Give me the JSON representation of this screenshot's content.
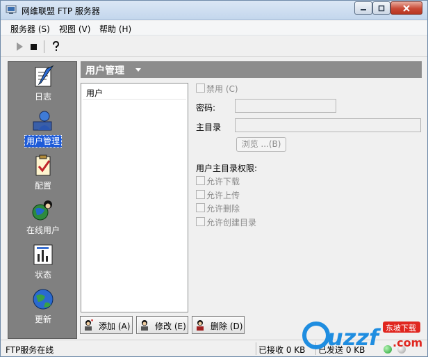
{
  "window": {
    "title": "网维联盟 FTP 服务器"
  },
  "menu": {
    "items": [
      "服务器 (S)",
      "视图 (V)",
      "帮助 (H)"
    ]
  },
  "toolbar": {
    "buttons": [
      "play-icon",
      "stop-icon",
      "help-icon"
    ]
  },
  "sidebar": {
    "items": [
      {
        "label": "日志",
        "icon": "log-icon"
      },
      {
        "label": "用户管理",
        "icon": "user-management-icon"
      },
      {
        "label": "配置",
        "icon": "config-icon"
      },
      {
        "label": "在线用户",
        "icon": "online-users-icon"
      },
      {
        "label": "状态",
        "icon": "status-icon"
      },
      {
        "label": "更新",
        "icon": "update-icon"
      }
    ],
    "active": "用户管理"
  },
  "main": {
    "header_title": "用户管理",
    "user_list_header": "用户",
    "form": {
      "disabled_label": "禁用 (C)",
      "password_label": "密码:",
      "homedir_label": "主目录",
      "browse_label": "浏览 ...(B)",
      "permissions_title": "用户主目录权限:",
      "permissions": [
        "允许下载",
        "允许上传",
        "允许删除",
        "允许创建目录"
      ]
    },
    "actions": {
      "add_label": "添加 (A)",
      "edit_label": "修改 (E)",
      "delete_label": "删除 (D)"
    }
  },
  "status": {
    "server_status": "FTP服务在线",
    "received": "已接收 0 KB",
    "sent": "已发送 0 KB"
  },
  "watermark": {
    "text": "uzzf",
    "sub": "东坡下载",
    "domain": ".com"
  }
}
